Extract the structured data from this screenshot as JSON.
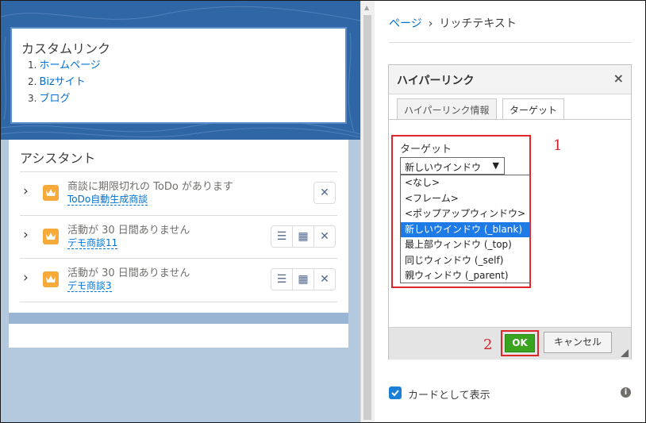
{
  "custom_links": {
    "title": "カスタムリンク",
    "items": [
      {
        "num": "1.",
        "label": "ホームページ"
      },
      {
        "num": "2.",
        "label": "Bizサイト"
      },
      {
        "num": "3.",
        "label": "ブログ"
      }
    ]
  },
  "assistant": {
    "title": "アシスタント",
    "rows": [
      {
        "text": "商談に期限切れの ToDo があります",
        "link": "ToDo自動生成商談"
      },
      {
        "text": "活動が 30 日間ありません",
        "link": "デモ商談11"
      },
      {
        "text": "活動が 30 日間ありません",
        "link": "デモ商談3"
      }
    ]
  },
  "breadcrumb": {
    "parent": "ページ",
    "separator": "›",
    "current": "リッチテキスト"
  },
  "dialog": {
    "title": "ハイパーリンク",
    "close": "×",
    "tabs": [
      "ハイパーリンク情報",
      "ターゲット"
    ],
    "target_label": "ターゲット",
    "selected": "新しいウインドウ",
    "options": [
      "<なし>",
      "<フレーム>",
      "<ポップアップウィンドウ>",
      "新しいウインドウ (_blank)",
      "最上部ウィンドウ (_top)",
      "同じウィンドウ (_self)",
      "親ウィンドウ (_parent)"
    ],
    "highlighted_option": "新しいウインドウ (_blank)",
    "ok_label": "OK",
    "cancel_label": "キャンセル",
    "annotation_1": "1",
    "annotation_2": "2"
  },
  "card_display": {
    "label": "カードとして表示",
    "checked": true,
    "info_icon": "info-icon"
  },
  "colors": {
    "accent": "#0070d2",
    "ok_green": "#3aa31f",
    "highlight": "#1e7be6",
    "annotation_red": "#e0252b",
    "header_blue": "#2f66a6"
  }
}
